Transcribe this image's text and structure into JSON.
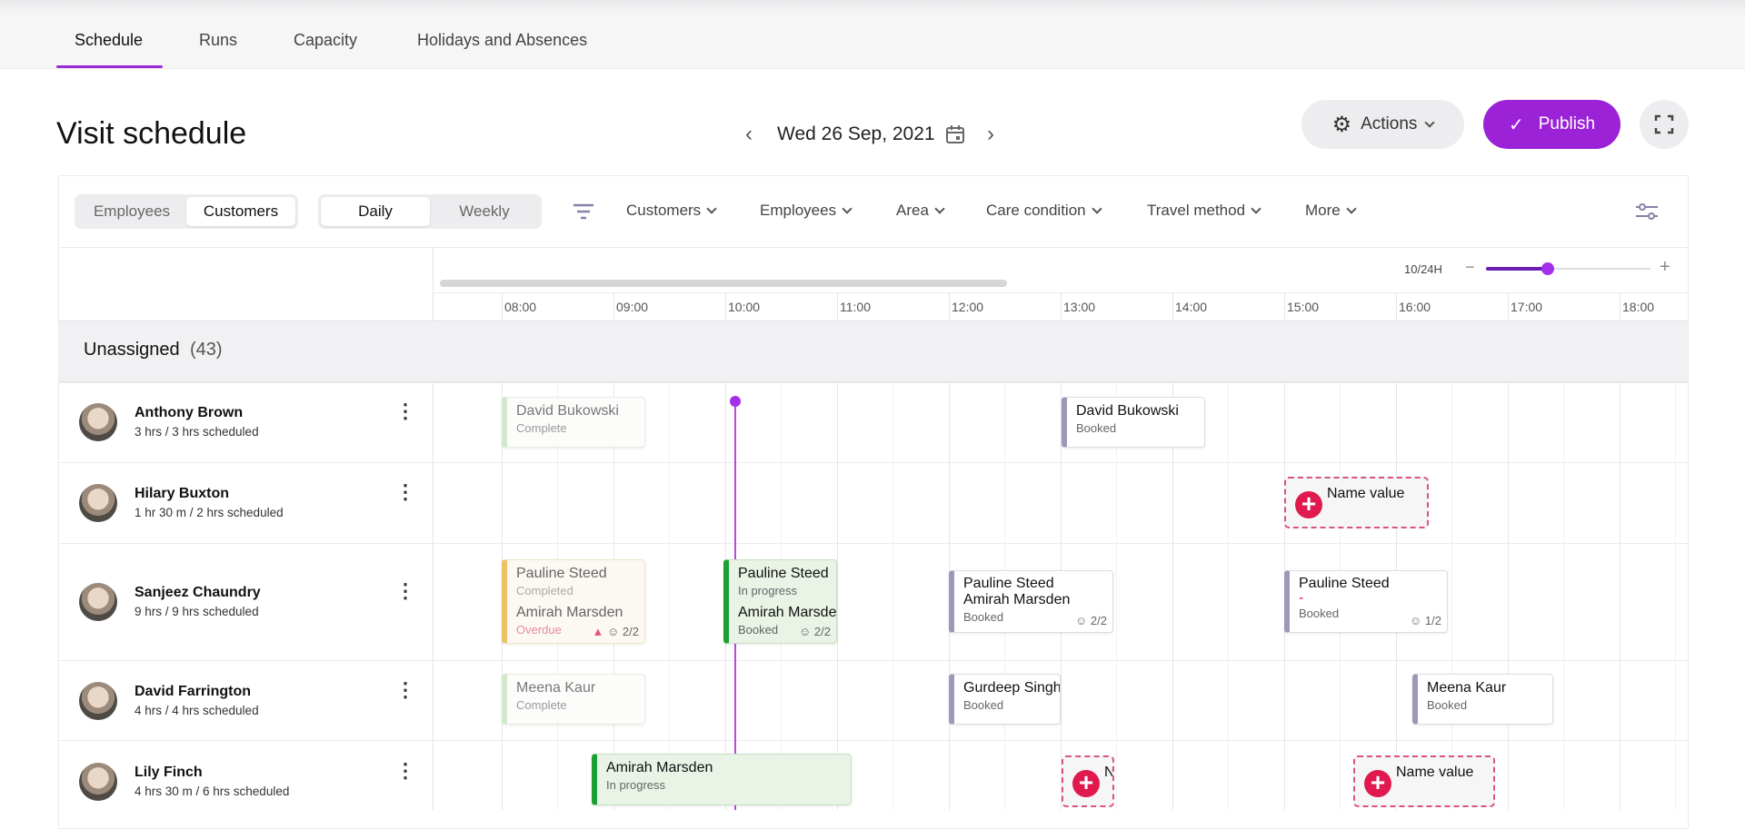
{
  "tabs": [
    "Schedule",
    "Runs",
    "Capacity",
    "Holidays and Absences"
  ],
  "header": {
    "title": "Visit schedule",
    "date": "Wed 26 Sep, 2021",
    "actions_label": "Actions",
    "publish_label": "Publish"
  },
  "colors": {
    "accent": "#9b22d6",
    "progress": "#1c9f34",
    "booked": "#9e98b8",
    "completed": "#ecc266",
    "unassigned": "#e0194f"
  },
  "toolbar": {
    "view_toggle": [
      "Employees",
      "Customers"
    ],
    "view_selected": "Customers",
    "period_toggle": [
      "Daily",
      "Weekly"
    ],
    "period_selected": "Daily",
    "filters": [
      "Customers",
      "Employees",
      "Area",
      "Care condition",
      "Travel method",
      "More"
    ]
  },
  "timeline": {
    "zoom_label": "10/24H",
    "zoom_level": 10,
    "zoom_max": 24,
    "hours": [
      "08:00",
      "09:00",
      "10:00",
      "11:00",
      "12:00",
      "13:00",
      "14:00",
      "15:00",
      "16:00",
      "17:00",
      "18:00"
    ]
  },
  "unassigned": {
    "label": "Unassigned",
    "count": "(43)"
  },
  "rows": [
    {
      "name": "Anthony Brown",
      "sub": "3 hrs / 3 hrs scheduled",
      "visits": [
        {
          "name": "David Bukowski",
          "status": "Complete"
        },
        {
          "name": "David Bukowski",
          "status": "Booked"
        }
      ]
    },
    {
      "name": "Hilary Buxton",
      "sub": "1 hr 30 m / 2 hrs scheduled",
      "visits": [
        {
          "name": "Name value"
        }
      ]
    },
    {
      "name": "Sanjeez Chaundry",
      "sub": "9 hrs / 9 hrs scheduled",
      "visits": [
        {
          "name": "Pauline Steed",
          "status": "Completed",
          "name2": "Amirah Marsden",
          "status2": "Overdue",
          "count": "2/2"
        },
        {
          "name": "Pauline Steed",
          "status": "In progress",
          "name2": "Amirah Marsden",
          "status2": "Booked",
          "count": "2/2"
        },
        {
          "name": "Pauline Steed",
          "name2": "Amirah Marsden",
          "status": "Booked",
          "count": "2/2"
        },
        {
          "name": "Pauline Steed",
          "name2": "-",
          "status": "Booked",
          "count": "1/2"
        }
      ]
    },
    {
      "name": "David Farrington",
      "sub": "4 hrs / 4 hrs scheduled",
      "visits": [
        {
          "name": "Meena Kaur",
          "status": "Complete"
        },
        {
          "name": "Gurdeep Singh",
          "status": "Booked"
        },
        {
          "name": "Meena Kaur",
          "status": "Booked"
        }
      ]
    },
    {
      "name": "Lily Finch",
      "sub": "4 hrs 30 m / 6 hrs scheduled",
      "visits": [
        {
          "name": "Amirah Marsden",
          "status": "In progress"
        },
        {
          "name": "N"
        },
        {
          "name": "Name value"
        }
      ]
    }
  ]
}
